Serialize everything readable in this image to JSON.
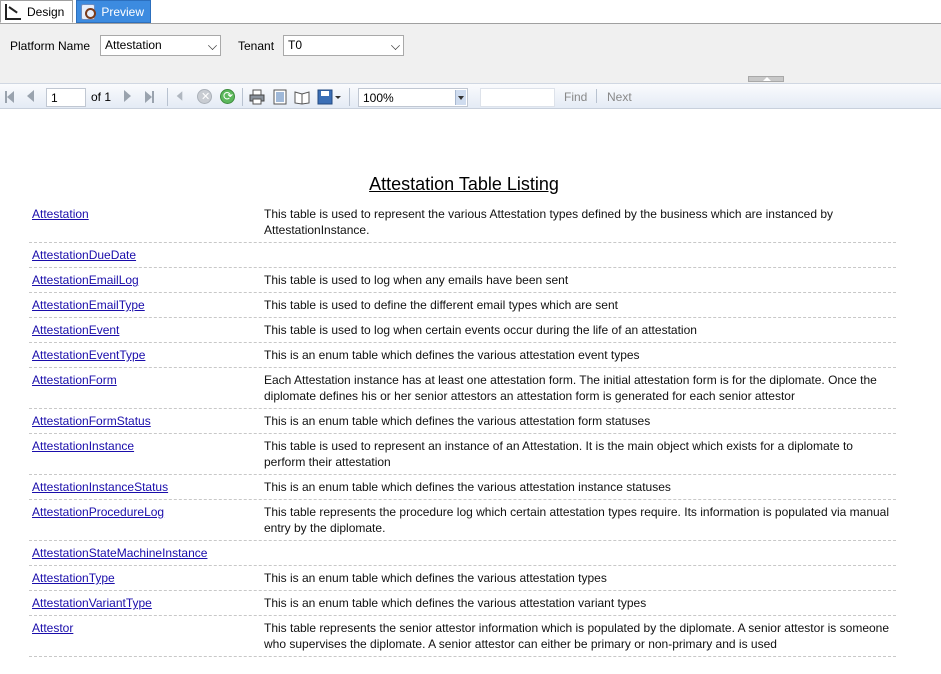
{
  "tabs": [
    {
      "label": "Design",
      "icon": "design-icon",
      "active": false
    },
    {
      "label": "Preview",
      "icon": "preview-icon",
      "active": true
    }
  ],
  "params": {
    "platform_label": "Platform Name",
    "platform_value": "Attestation",
    "tenant_label": "Tenant",
    "tenant_value": "T0"
  },
  "toolbar": {
    "page_current": "1",
    "page_of": "of",
    "page_total": "1",
    "zoom": "100%",
    "find_label": "Find",
    "next_label": "Next"
  },
  "report": {
    "title": "Attestation Table Listing",
    "rows": [
      {
        "name": "Attestation",
        "desc": "This table is used to represent the various Attestation types defined by the business which are instanced by AttestationInstance."
      },
      {
        "name": "AttestationDueDate",
        "desc": ""
      },
      {
        "name": "AttestationEmailLog",
        "desc": "This table is used to log when any emails have been sent"
      },
      {
        "name": "AttestationEmailType",
        "desc": "This table is used to define the different email types which are sent"
      },
      {
        "name": "AttestationEvent",
        "desc": "This table is used to log when certain events occur during the life of an attestation"
      },
      {
        "name": "AttestationEventType",
        "desc": "This is an enum table which defines the various attestation event types"
      },
      {
        "name": "AttestationForm",
        "desc": "Each Attestation instance has at least one attestation form.  The initial attestation form is for the diplomate.  Once the diplomate defines his or her senior attestors an attestation form is generated for each senior attestor"
      },
      {
        "name": "AttestationFormStatus",
        "desc": "This is an enum table which defines the various attestation form statuses"
      },
      {
        "name": "AttestationInstance",
        "desc": "This table is used to represent an instance of an Attestation.  It is the main object which exists for a diplomate to perform their attestation"
      },
      {
        "name": "AttestationInstanceStatus",
        "desc": "This is an enum table which defines the various attestation instance statuses"
      },
      {
        "name": "AttestationProcedureLog",
        "desc": "This table represents the procedure log which certain attestation types require.  Its information is populated via manual entry by the diplomate."
      },
      {
        "name": "AttestationStateMachineInstance",
        "desc": ""
      },
      {
        "name": "AttestationType",
        "desc": "This is an enum table which defines the various attestation types"
      },
      {
        "name": "AttestationVariantType",
        "desc": "This is an enum table which defines the various attestation variant types"
      },
      {
        "name": "Attestor",
        "desc": " This table represents the senior attestor information which is populated by the diplomate.  A senior attestor is someone who supervises the diplomate. A senior attestor can either be primary or non-primary and is used"
      }
    ]
  }
}
